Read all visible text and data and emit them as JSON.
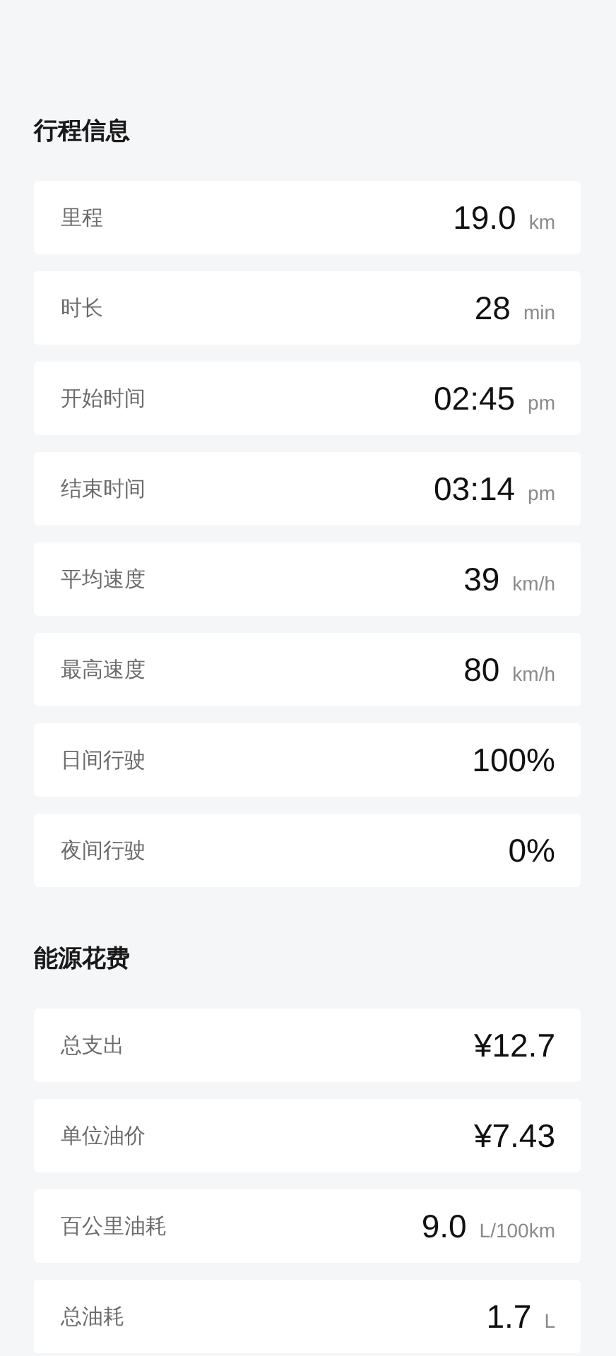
{
  "sections": [
    {
      "title": "行程信息",
      "rows": [
        {
          "label": "里程",
          "value": "19.0",
          "unit": "km"
        },
        {
          "label": "时长",
          "value": "28",
          "unit": "min"
        },
        {
          "label": "开始时间",
          "value": "02:45",
          "unit": "pm"
        },
        {
          "label": "结束时间",
          "value": "03:14",
          "unit": "pm"
        },
        {
          "label": "平均速度",
          "value": "39",
          "unit": "km/h"
        },
        {
          "label": "最高速度",
          "value": "80",
          "unit": "km/h"
        },
        {
          "label": "日间行驶",
          "value": "100%"
        },
        {
          "label": "夜间行驶",
          "value": "0%"
        }
      ]
    },
    {
      "title": "能源花费",
      "rows": [
        {
          "label": "总支出",
          "value": "¥12.7"
        },
        {
          "label": "单位油价",
          "value": "¥7.43"
        },
        {
          "label": "百公里油耗",
          "value": "9.0",
          "unit": "L/100km"
        },
        {
          "label": "总油耗",
          "value": "1.7",
          "unit": "L"
        }
      ]
    }
  ]
}
